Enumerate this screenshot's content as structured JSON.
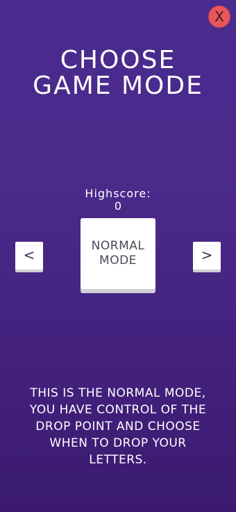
{
  "close_button": {
    "label": "X",
    "color": "#e8565c"
  },
  "title": "CHOOSE\nGAME MODE",
  "highscore": {
    "label": "Highscore:",
    "value": "0"
  },
  "navigation": {
    "prev_label": "<",
    "next_label": ">"
  },
  "mode_card": {
    "label": "NORMAL\nMODE"
  },
  "description": "THIS IS THE NORMAL MODE,\nYOU HAVE CONTROL OF THE\nDROP POINT AND CHOOSE\nWHEN TO DROP YOUR\nLETTERS.",
  "colors": {
    "background_top": "#4a2b8e",
    "background_bottom": "#3b1a70",
    "card": "#ffffff"
  }
}
